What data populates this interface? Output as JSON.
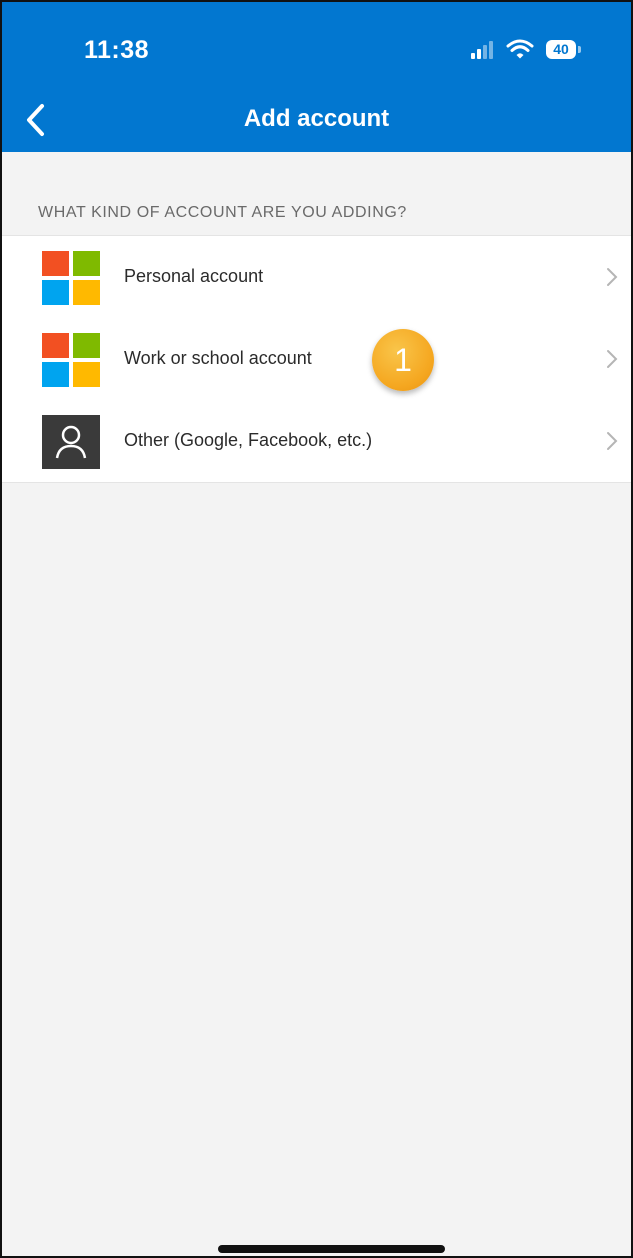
{
  "status_bar": {
    "time": "11:38",
    "battery": "40",
    "icons": [
      "cellular-signal-icon",
      "wifi-icon",
      "battery-icon"
    ]
  },
  "nav": {
    "title": "Add account",
    "back_icon": "chevron-left-icon"
  },
  "section": {
    "label": "WHAT KIND OF ACCOUNT ARE YOU ADDING?"
  },
  "accounts": [
    {
      "label": "Personal account",
      "icon": "microsoft-logo-icon"
    },
    {
      "label": "Work or school account",
      "icon": "microsoft-logo-icon"
    },
    {
      "label": "Other (Google, Facebook, etc.)",
      "icon": "person-icon"
    }
  ],
  "annotation": {
    "badge": "1",
    "color": "#f5a720"
  },
  "colors": {
    "header": "#0277d0",
    "background": "#f3f3f3",
    "ms_red": "#f25022",
    "ms_green": "#7fba00",
    "ms_blue": "#00a4ef",
    "ms_yellow": "#ffb900"
  }
}
